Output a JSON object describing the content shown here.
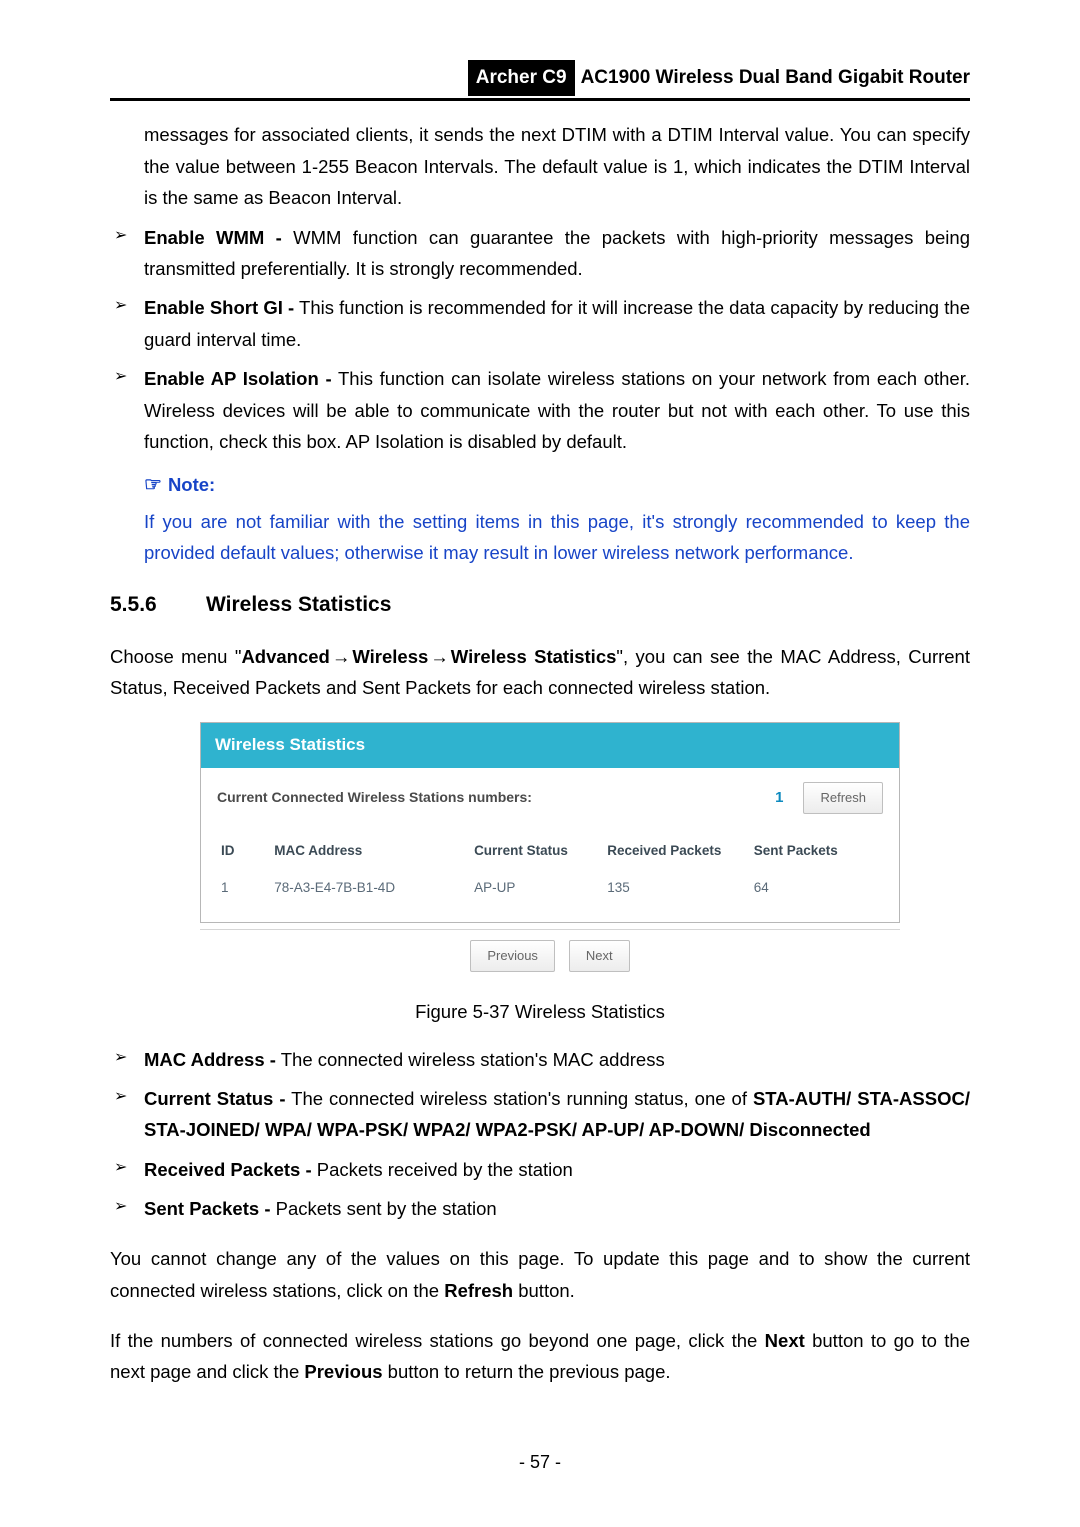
{
  "header": {
    "model": "Archer C9",
    "product": "AC1900 Wireless Dual Band Gigabit Router"
  },
  "intro_continued": "messages for associated clients, it sends the next DTIM with a DTIM Interval value. You can specify the value between 1-255 Beacon Intervals. The default value is 1, which indicates the DTIM Interval is the same as Beacon Interval.",
  "bullets_top": [
    {
      "label": "Enable WMM -",
      "text": " WMM function can guarantee the packets with high-priority messages being transmitted preferentially. It is strongly recommended."
    },
    {
      "label": "Enable Short GI -",
      "text": " This function is recommended for it will increase the data capacity by reducing the guard interval time."
    },
    {
      "label": "Enable AP Isolation -",
      "text": " This function can isolate wireless stations on your network from each other. Wireless devices will be able to communicate with the router but not with each other. To use this function, check this box. AP Isolation is disabled by default."
    }
  ],
  "note": {
    "head": "Note:",
    "text": "If you are not familiar with the setting items in this page, it's strongly recommended to keep the provided default values; otherwise it may result in lower wireless network performance."
  },
  "section": {
    "num": "5.5.6",
    "title": "Wireless Statistics"
  },
  "menu_sentence": {
    "pre": "Choose menu \"",
    "p1": "Advanced",
    "arr": "→",
    "p2": "Wireless",
    "p3": "Wireless Statistics",
    "post": "\", you can see the MAC Address, Current Status, Received Packets and Sent Packets for each connected wireless station."
  },
  "figure": {
    "title": "Wireless Statistics",
    "connected_label": "Current Connected Wireless Stations numbers:",
    "connected_count": "1",
    "refresh": "Refresh",
    "cols": {
      "id": "ID",
      "mac": "MAC Address",
      "status": "Current Status",
      "recv": "Received Packets",
      "sent": "Sent Packets"
    },
    "rows": [
      {
        "id": "1",
        "mac": "78-A3-E4-7B-B1-4D",
        "status": "AP-UP",
        "recv": "135",
        "sent": "64"
      }
    ],
    "prev": "Previous",
    "next": "Next"
  },
  "caption": "Figure 5-37 Wireless Statistics",
  "bullets_bottom": [
    {
      "label": "MAC Address -",
      "text": " The connected wireless station's MAC address"
    },
    {
      "label": "Current Status -",
      "text_pre": " The connected wireless station's running status, one of ",
      "text_bold": "STA-AUTH/ STA-ASSOC/ STA-JOINED/ WPA/ WPA-PSK/ WPA2/ WPA2-PSK/ AP-UP/ AP-DOWN/ Disconnected"
    },
    {
      "label": "Received Packets -",
      "text": " Packets received by the station"
    },
    {
      "label": "Sent Packets -",
      "text": " Packets sent by the station"
    }
  ],
  "para1_pre": "You cannot change any of the values on this page. To update this page and to show the current connected wireless stations, click on the ",
  "para1_b": "Refresh",
  "para1_post": " button.",
  "para2_pre": "If the numbers of connected wireless stations go beyond one page, click the ",
  "para2_b1": "Next",
  "para2_mid": " button to go to the next page and click the ",
  "para2_b2": "Previous",
  "para2_post": " button to return the previous page.",
  "page_number": "- 57 -"
}
